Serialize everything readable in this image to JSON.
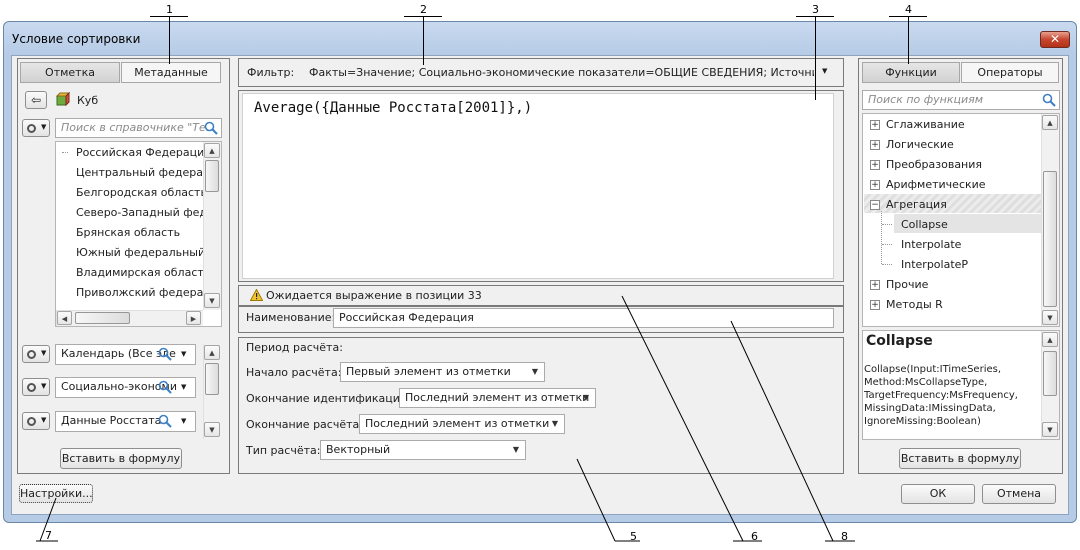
{
  "window": {
    "title": "Условие сортировки",
    "close_label": "✕"
  },
  "callouts": [
    "1",
    "2",
    "3",
    "4",
    "5",
    "6",
    "7",
    "8"
  ],
  "left": {
    "tabs": [
      "Отметка",
      "Метаданные"
    ],
    "breadcrumb": "Куб",
    "search_placeholder": "Поиск в справочнике \"Те...",
    "items": [
      "Российская Федерация",
      "Центральный федераль",
      "Белгородская область",
      "Северо-Западный феде",
      "Брянская область",
      "Южный федеральный о",
      "Владимирская область",
      "Приволжский федераль"
    ],
    "dims": [
      "Календарь (Все эле",
      "Социально-экономи",
      "Данные Росстата"
    ],
    "insert_label": "Вставить в формулу"
  },
  "center": {
    "filter_label": "Фильтр:",
    "filter_value": "Факты=Значение; Социально-экономические показатели=ОБЩИЕ СВЕДЕНИЯ; Источники данны...",
    "formula": "Average({Данные Росстата[2001]},)",
    "warning": "Ожидается выражение в позиции 33",
    "name_label": "Наименование:",
    "name_value": "Российская Федерация",
    "period_title": "Период расчёта:",
    "start_label": "Начало расчёта:",
    "start_value": "Первый элемент из отметки",
    "ident_label": "Окончание идентификации:",
    "ident_value": "Последний элемент из отметки",
    "end_label": "Окончание расчёта:",
    "end_value": "Последний элемент из отметки",
    "type_label": "Тип расчёта:",
    "type_value": "Векторный"
  },
  "right": {
    "tabs": [
      "Функции",
      "Операторы"
    ],
    "search_placeholder": "Поиск по функциям",
    "groups": [
      "Сглаживание",
      "Логические",
      "Преобразования",
      "Арифметические",
      "Агрегация"
    ],
    "children": [
      "Collapse",
      "Interpolate",
      "InterpolateP"
    ],
    "groups_after": [
      "Прочие",
      "Методы R"
    ],
    "selected": "Collapse",
    "desc_title": "Collapse",
    "desc_lines": [
      "Collapse(Input:ITimeSeries,",
      "Method:MsCollapseType,",
      "TargetFrequency:MsFrequency,",
      "MissingData:IMissingData,",
      "IgnoreMissing:Boolean)"
    ],
    "insert_label": "Вставить в формулу"
  },
  "footer": {
    "settings_label": "Настройки...",
    "ok_label": "ОК",
    "cancel_label": "Отмена"
  }
}
